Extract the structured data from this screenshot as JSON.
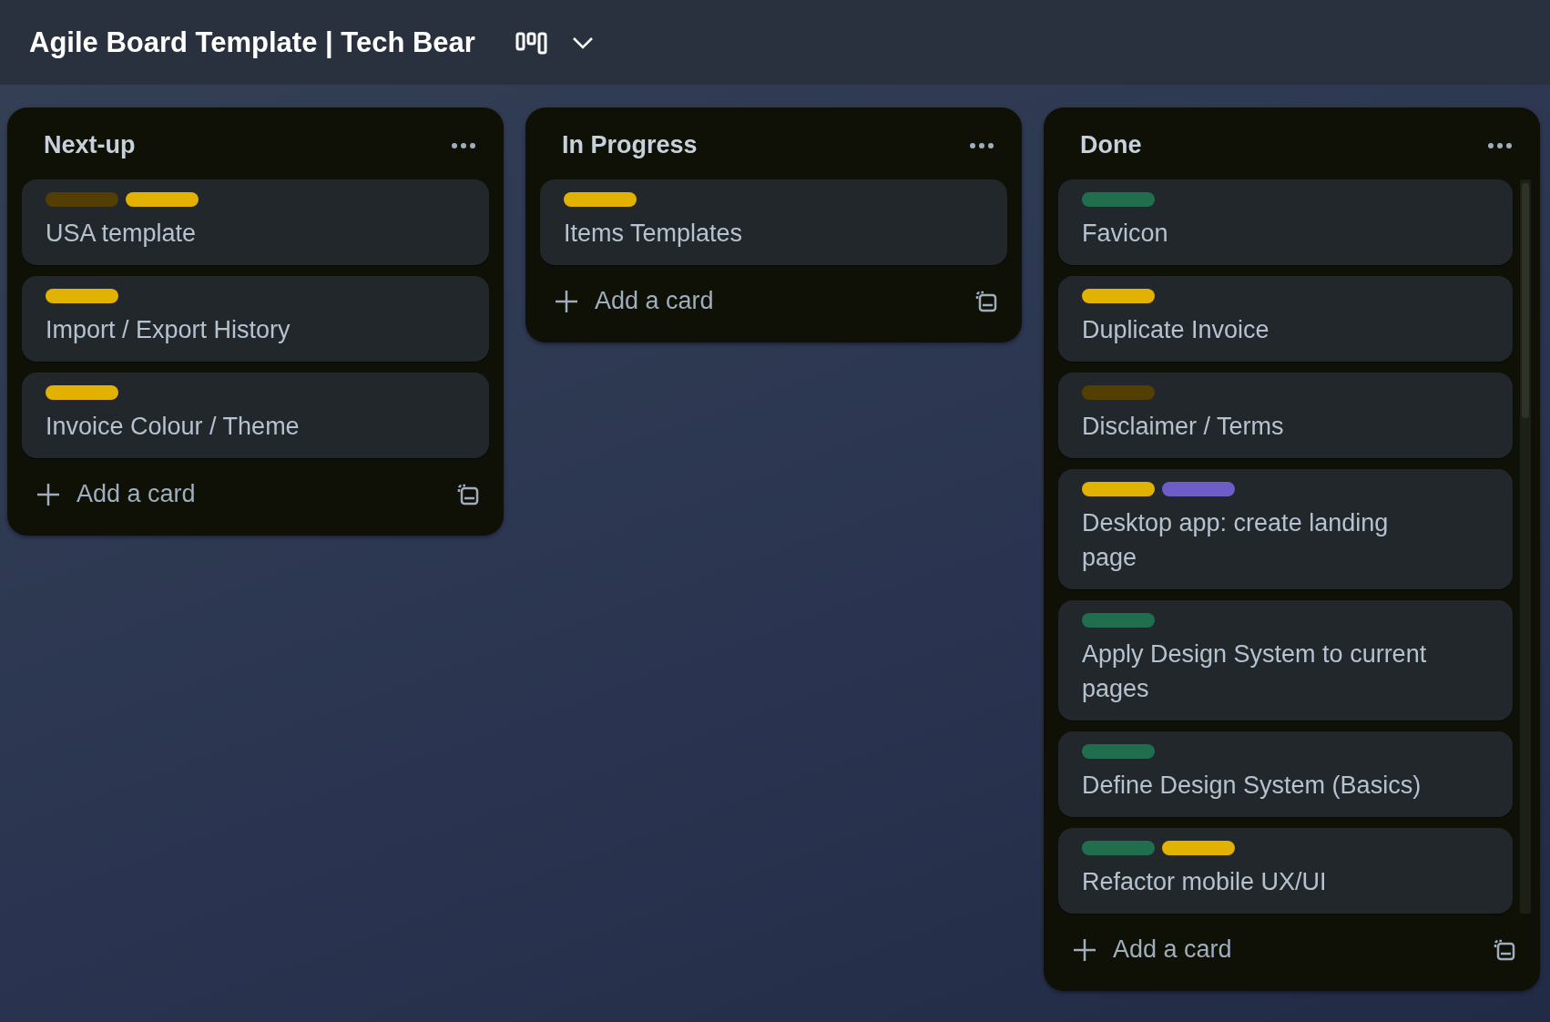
{
  "board": {
    "title": "Agile Board Template | Tech Bear"
  },
  "lists": [
    {
      "title": "Next-up",
      "scrollbar": false,
      "add_label": "Add a card",
      "cards": [
        {
          "title": "USA template",
          "labels": [
            {
              "color": "#533f04"
            },
            {
              "color": "#e2b203"
            }
          ]
        },
        {
          "title": "Import / Export History",
          "labels": [
            {
              "color": "#e2b203"
            }
          ]
        },
        {
          "title": "Invoice Colour / Theme",
          "labels": [
            {
              "color": "#e2b203"
            }
          ]
        }
      ]
    },
    {
      "title": "In Progress",
      "scrollbar": false,
      "add_label": "Add a card",
      "cards": [
        {
          "title": "Items Templates",
          "labels": [
            {
              "color": "#e2b203"
            }
          ]
        }
      ]
    },
    {
      "title": "Done",
      "scrollbar": true,
      "add_label": "Add a card",
      "cards": [
        {
          "title": "Favicon",
          "labels": [
            {
              "color": "#216e4e"
            }
          ]
        },
        {
          "title": "Duplicate Invoice",
          "labels": [
            {
              "color": "#e2b203"
            }
          ]
        },
        {
          "title": "Disclaimer / Terms",
          "labels": [
            {
              "color": "#533f04"
            }
          ]
        },
        {
          "title": "Desktop app: create landing page",
          "labels": [
            {
              "color": "#e2b203"
            },
            {
              "color": "#6e5dc6"
            }
          ]
        },
        {
          "title": "Apply Design System to current pages",
          "labels": [
            {
              "color": "#216e4e"
            }
          ]
        },
        {
          "title": "Define Design System (Basics)",
          "labels": [
            {
              "color": "#216e4e"
            }
          ]
        },
        {
          "title": "Refactor mobile UX/UI",
          "labels": [
            {
              "color": "#216e4e"
            },
            {
              "color": "#e2b203"
            }
          ]
        }
      ]
    }
  ]
}
